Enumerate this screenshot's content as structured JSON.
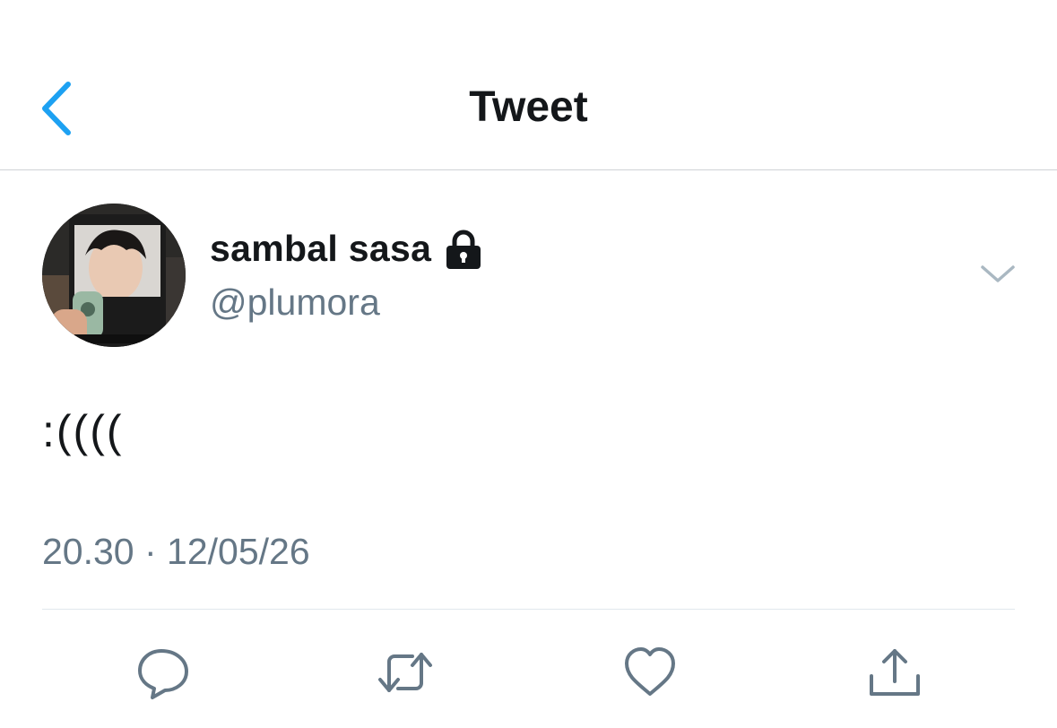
{
  "header": {
    "title": "Tweet"
  },
  "tweet": {
    "author": {
      "display_name": "sambal sasa",
      "handle": "@plumora",
      "protected": true
    },
    "text": ":((((",
    "timestamp": "20.30 · 12/05/26"
  },
  "icons": {
    "back": "chevron-left-icon",
    "lock": "lock-icon",
    "more": "chevron-down-icon",
    "reply": "reply-icon",
    "retweet": "retweet-icon",
    "like": "heart-icon",
    "share": "share-icon"
  },
  "colors": {
    "accent": "#1da1f2",
    "secondary_text": "#657786",
    "primary_text": "#14171a",
    "divider": "#cfd3d6"
  }
}
